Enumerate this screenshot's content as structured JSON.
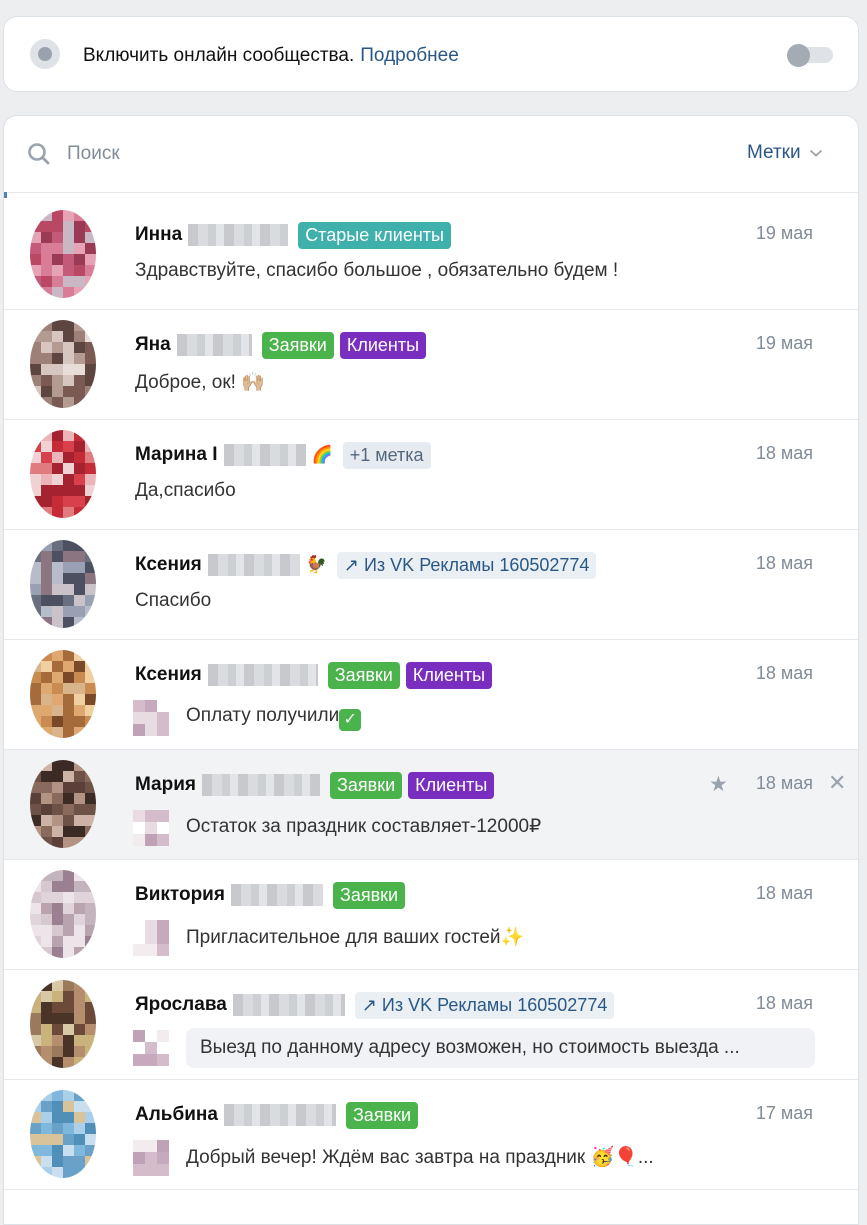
{
  "online_banner": {
    "text": "Включить онлайн сообщества.",
    "link": "Подробнее"
  },
  "search": {
    "placeholder": "Поиск",
    "labels_filter": "Метки"
  },
  "colors": {
    "tag_old_clients": "#3fb0ac",
    "tag_applications": "#4bb34b",
    "tag_clients": "#792ec0",
    "link": "#2a5885"
  },
  "conversations": [
    {
      "name": "Инна",
      "emoji": "",
      "tags": [
        {
          "label": "Старые клиенты",
          "kind": "old"
        }
      ],
      "date": "19 мая",
      "message": "Здравствуйте, спасибо большое , обязательно будем !",
      "message_style": "plain"
    },
    {
      "name": "Яна",
      "emoji": "",
      "tags": [
        {
          "label": "Заявки",
          "kind": "apps"
        },
        {
          "label": "Клиенты",
          "kind": "clients"
        }
      ],
      "date": "19 мая",
      "message": "Доброе, ок! 🙌🏼",
      "message_style": "plain"
    },
    {
      "name": "Марина I",
      "emoji": "🌈",
      "tags": [
        {
          "label": "+1 метка",
          "kind": "more"
        }
      ],
      "date": "18 мая",
      "message": "Да,спасибо",
      "message_style": "plain"
    },
    {
      "name": "Ксения",
      "emoji": "🐓",
      "tags": [
        {
          "label": "↗ Из VK Рекламы 160502774",
          "kind": "ad"
        }
      ],
      "date": "18 мая",
      "message": "Спасибо",
      "message_style": "plain"
    },
    {
      "name": "Ксения",
      "emoji": "",
      "tags": [
        {
          "label": "Заявки",
          "kind": "apps"
        },
        {
          "label": "Клиенты",
          "kind": "clients"
        }
      ],
      "date": "18 мая",
      "message": "Оплату получили",
      "message_style": "thumb-check"
    },
    {
      "name": "Мария",
      "emoji": "",
      "tags": [
        {
          "label": "Заявки",
          "kind": "apps"
        },
        {
          "label": "Клиенты",
          "kind": "clients"
        }
      ],
      "date": "18 мая",
      "message": "Остаток за праздник составляет-12000₽",
      "message_style": "thumb",
      "hovered": true
    },
    {
      "name": "Виктория",
      "emoji": "",
      "tags": [
        {
          "label": "Заявки",
          "kind": "apps"
        }
      ],
      "date": "18 мая",
      "message": "Пригласительное для ваших гостей✨",
      "message_style": "thumb"
    },
    {
      "name": "Ярослава",
      "emoji": "",
      "tags": [
        {
          "label": "↗ Из VK Рекламы 160502774",
          "kind": "ad"
        }
      ],
      "date": "18 мая",
      "message": "Выезд по данному адресу возможен, но стоимость выезда ...",
      "message_style": "bubble"
    },
    {
      "name": "Альбина",
      "emoji": "",
      "tags": [
        {
          "label": "Заявки",
          "kind": "apps"
        }
      ],
      "date": "17 мая",
      "message": "Добрый вечер! Ждём вас завтра на праздник 🥳🎈...",
      "message_style": "thumb"
    }
  ]
}
